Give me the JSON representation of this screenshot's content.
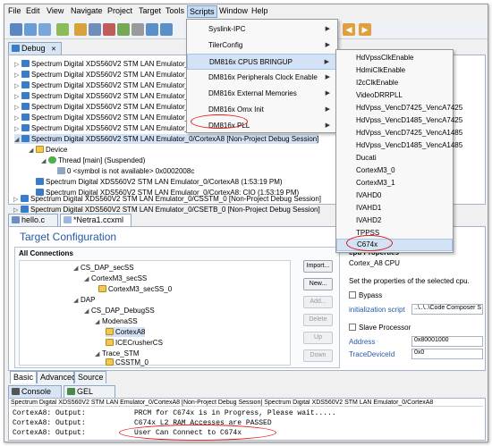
{
  "menubar": {
    "items": [
      "File",
      "Edit",
      "View",
      "Navigate",
      "Project",
      "Target",
      "Tools",
      "Scripts",
      "Window",
      "Help"
    ],
    "active": "Scripts"
  },
  "debug_view": {
    "tab_label": "Debug",
    "tab_close": "✕",
    "rows": [
      "Spectrum Digital XDS560V2 STM LAN Emulator_0/...",
      "Spectrum Digital XDS560V2 STM LAN Emulator_0/...",
      "Spectrum Digital XDS560V2 STM LAN Emulator_0/...",
      "Spectrum Digital XDS560V2 STM LAN Emulator_0/...",
      "Spectrum Digital XDS560V2 STM LAN Emulator_0/...",
      "Spectrum Digital XDS560V2 STM LAN Emulator_0/...",
      "Spectrum Digital XDS560V2 STM LAN Emulator_0/...",
      "Spectrum Digital XDS560V2 STM LAN Emulator_0/..."
    ],
    "selected_session": "Spectrum Digital XDS560V2 STM LAN Emulator_0/CortexA8 [Non-Project Debug Session]",
    "device": "Device",
    "thread": "Thread [main] (Suspended)",
    "frame": "0 <symbol is not available> 0x0002008c",
    "cortexa8_line": "Spectrum Digital XDS560V2 STM LAN Emulator_0/CortexA8 (1:53:19 PM)",
    "cio_line": "Spectrum Digital XDS560V2 STM LAN Emulator_0/CortexA8: CIO (1:53:19 PM)",
    "csstm_line": "Spectrum Digital XDS560V2 STM LAN Emulator_0/CSSTM_0 [Non-Project Debug Session]",
    "csetb_line": "Spectrum Digital XDS560V2 STM LAN Emulator_0/CSETB_0 [Non-Project Debug Session]"
  },
  "scripts_menu": {
    "items": [
      {
        "label": "Syslink-IPC",
        "submenu": true
      },
      {
        "label": "TilerConfig",
        "submenu": true
      },
      {
        "label": "DM816x CPUS BRINGUP",
        "submenu": true
      },
      {
        "label": "DM816x Peripherals Clock Enable",
        "submenu": true
      },
      {
        "label": "DM816x External Memories",
        "submenu": true
      },
      {
        "label": "DM816x Omx Init",
        "submenu": true
      },
      {
        "label": "DM816x PLL",
        "submenu": true
      }
    ]
  },
  "cpus_submenu": {
    "items": [
      "HdVpssClkEnable",
      "HdmiClkEnable",
      "I2cClkEnable",
      "VideoDRRPLL",
      "HdVpss_VencD7425_VencA7425",
      "HdVpss_VencD1485_VencA7425",
      "HdVpss_VencD7425_VencA1485",
      "HdVpss_VencD1485_VencA1485",
      "Ducati",
      "CortexM3_0",
      "CortexM3_1",
      "IVAHD0",
      "IVAHD1",
      "IVAHD2",
      "TPPSS",
      "C674x"
    ]
  },
  "editor_tabs": [
    "hello.c",
    "*Netra1.ccxml"
  ],
  "target_config": {
    "title": "Target Configuration",
    "all_connections": "All Connections",
    "tree": [
      "CS_DAP_secSS",
      "CortexM3_secSS",
      "CortexM3_secSS_0",
      "DAP",
      "CS_DAP_DebugSS",
      "ModenaSS",
      "CortexA8",
      "ICECrusherCS",
      "Trace_STM",
      "CSSTM_0"
    ],
    "buttons": [
      "Import...",
      "New...",
      "Add...",
      "Delete",
      "Up",
      "Down"
    ],
    "bottom_tabs": [
      "Basic",
      "Advanced",
      "Source"
    ]
  },
  "cpu_properties": {
    "title": "cpu Properties",
    "cpu_name": "Cortex_A8 CPU",
    "desc": "Set the properties of the selected cpu.",
    "bypass": "Bypass",
    "init_script_label": "initialization script",
    "init_script_value": "..\\..\\..\\Code Composer S",
    "slave": "Slave Processor",
    "address_label": "Address",
    "address_value": "0x80001000",
    "trace_label": "TraceDeviceId",
    "trace_value": "0x0"
  },
  "console": {
    "tabs": [
      "Console",
      "GEL Files"
    ],
    "session": "Spectrum Digital XDS560V2 STM LAN Emulator_0/CortexA8 [Non-Project Debug Session] Spectrum Digital XDS560V2 STM LAN Emulator_0/CortexA8",
    "lines": [
      {
        "src": "CortexA8: Output:",
        "msg": "PRCM for C674x is in Progress, Please wait....."
      },
      {
        "src": "CortexA8: Output:",
        "msg": "C674x L2 RAM Accesses are PASSED"
      },
      {
        "src": "CortexA8: Output:",
        "msg": "User Can Connect to C674x"
      }
    ]
  },
  "colors": {
    "accent": "#3a7cc9",
    "highlight": "#d3e3f5",
    "annotation": "#e02020",
    "title_blue": "#2459a6"
  }
}
